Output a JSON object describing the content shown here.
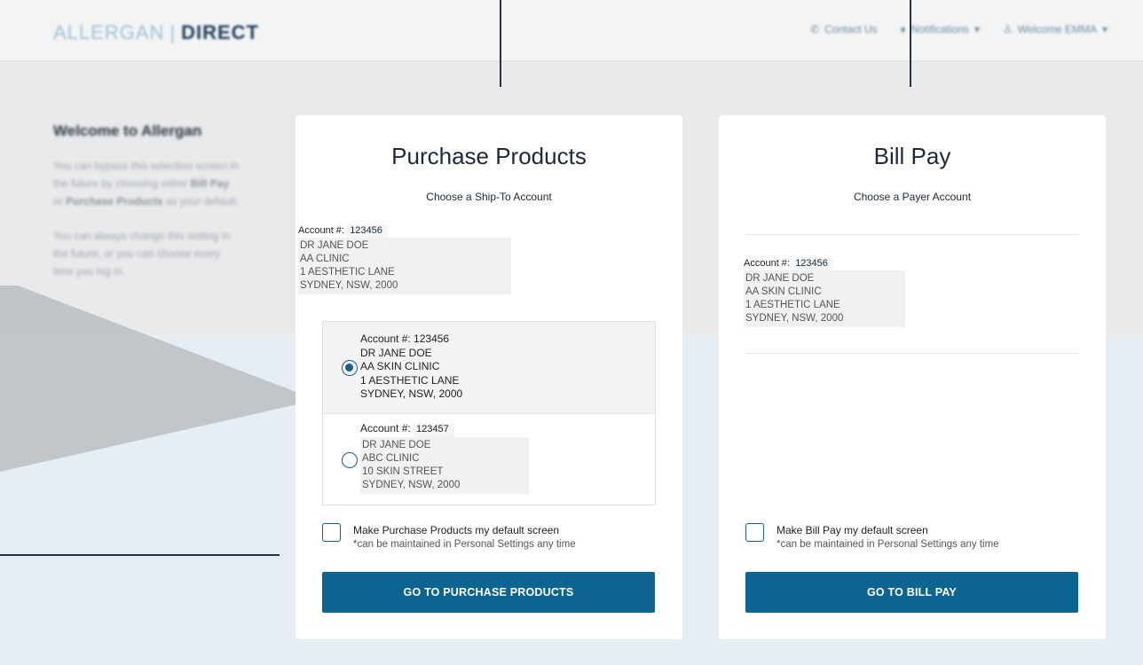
{
  "header": {
    "logo_brand": "ALLERGAN",
    "logo_sep": "|",
    "logo_direct": "DIRECT",
    "contact_label": "Contact Us",
    "notifications_label": "Notifications",
    "welcome_label": "Welcome EMMA"
  },
  "sidebar": {
    "title": "Welcome to Allergan",
    "para1_a": "You can bypass this selection screen in the future by choosing either ",
    "para1_bill": "Bill Pay",
    "para1_or": " or ",
    "para1_purchase": "Purchase Products",
    "para1_b": " as your default.",
    "para2": "You can always change this setting in the future, or you can choose every time you log in."
  },
  "purchase": {
    "title": "Purchase Products",
    "subtitle": "Choose a Ship-To Account",
    "account_label": "Account #:",
    "account_number": "123456",
    "address": [
      "DR JANE DOE",
      "AA CLINIC",
      "1 AESTHETIC LANE",
      "SYDNEY, NSW, 2000"
    ],
    "options": [
      {
        "account_label": "Account #:",
        "account_number": "123456",
        "lines": [
          "DR JANE DOE",
          "AA SKIN CLINIC",
          "1 AESTHETIC LANE",
          "SYDNEY, NSW, 2000"
        ],
        "selected": true
      },
      {
        "account_label": "Account #:",
        "account_number": "123457",
        "lines": [
          "DR JANE DOE",
          "ABC CLINIC",
          "10 SKIN STREET",
          "SYDNEY, NSW, 2000"
        ],
        "selected": false
      }
    ],
    "default_label": "Make Purchase Products my default screen",
    "default_note": "*can be maintained in Personal Settings any time",
    "button_label": "GO TO PURCHASE PRODUCTS"
  },
  "billpay": {
    "title": "Bill Pay",
    "subtitle": "Choose a Payer Account",
    "account_label": "Account #:",
    "account_number": "123456",
    "address": [
      "DR JANE DOE",
      "AA SKIN CLINIC",
      "1 AESTHETIC LANE",
      "SYDNEY, NSW, 2000"
    ],
    "default_label": "Make Bill Pay my default screen",
    "default_note": "*can be maintained in Personal Settings any time",
    "button_label": "GO TO BILL PAY"
  },
  "colors": {
    "brand_blue": "#0c6591",
    "radio_blue": "#1b5e86",
    "annotation_line": "#2c2f4e"
  }
}
